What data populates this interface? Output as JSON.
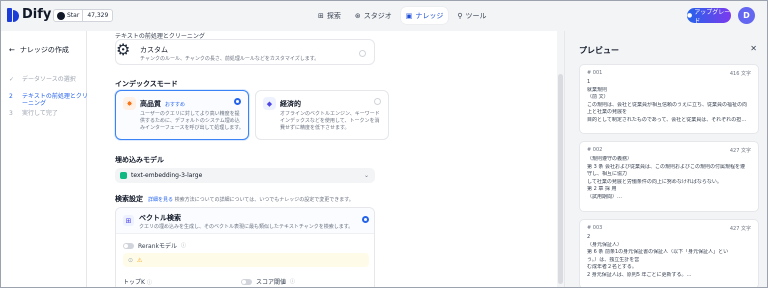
{
  "app": {
    "name": "Dify",
    "github": {
      "label": "Star",
      "count": "47,329"
    },
    "nav": [
      {
        "icon": "⊞",
        "label": "探索"
      },
      {
        "icon": "⊛",
        "label": "スタジオ"
      },
      {
        "icon": "▣",
        "label": "ナレッジ"
      },
      {
        "icon": "⚲",
        "label": "ツール"
      }
    ],
    "upgrade_label": "アップグレード",
    "avatar_letter": "D"
  },
  "steps": {
    "back_label": "ナレッジの作成",
    "items": [
      {
        "n": "✓",
        "label": "データソースの選択"
      },
      {
        "n": "2",
        "label": "テキストの前処理とクリーニング"
      },
      {
        "n": "3",
        "label": "実行して完了"
      }
    ]
  },
  "main": {
    "section_top": "テキストの前処理とクリーニング",
    "custom": {
      "title": "カスタム",
      "desc": "チャンクのルール、チャンクの長さ、前処理ルールなどをカスタマイズします。"
    },
    "index_mode_label": "インデックスモード",
    "high_quality": {
      "title": "高品質",
      "badge": "おすすめ",
      "desc": "ユーザーのクエリに対してより高い精度を提供するために、デフォルトのシステム埋め込みインターフェースを呼び出して処理します。"
    },
    "economical": {
      "title": "経済的",
      "desc": "オフラインのベクトルエンジン、キーワードインデックスなどを使用して、トークンを消費せずに精度を低下させます。"
    },
    "embedding_label": "埋め込みモデル",
    "embedding_value": "text-embedding-3-large",
    "search_label": "検索設定",
    "search_help_link": "詳細を見る",
    "search_help_text": "検索方法についての詳細については、いつでもナレッジの設定で変更できます。",
    "vector": {
      "title": "ベクトル検索",
      "desc": "クエリの埋め込みを生成し、そのベクトル表現に最も類似したテキストチャンクを検索します。"
    },
    "rerank_label": "Rerankモデル",
    "topk_label": "トップK",
    "score_label": "スコア閾値"
  },
  "preview": {
    "title": "プレビュー",
    "chunks": [
      {
        "id": "# 001",
        "chars": "416 文字",
        "lines": [
          "1",
          "就業規則",
          "（前 文）",
          "この規則は、会社と従業員が相互信頼のうえに立ち、従業員の福祉の向",
          "上と社業の発展を",
          "目的として制定されたものであって、会社と従業員は、それぞれの担当す…"
        ]
      },
      {
        "id": "# 002",
        "chars": "427 文字",
        "lines": [
          "（規則遵守の義務）",
          "第 3 条 会社および従業員は、この規則およびこの規則の付属規程を遵",
          "守し、相互に協力",
          "して社業の発展と労働条件の向上に努めなければならない。",
          "第 2 章 採 用",
          "（試用期間）…"
        ]
      },
      {
        "id": "# 003",
        "chars": "427 文字",
        "lines": [
          "2",
          "（身元保証人）",
          "第 6 条 前条1の身元保証書の保証人（以下「身元保証人」とい",
          "う。）は、独立生計を営",
          "む成年者２名とする。",
          "2 身元保証人は、原則5 年ごとに更新する。…"
        ]
      }
    ]
  }
}
